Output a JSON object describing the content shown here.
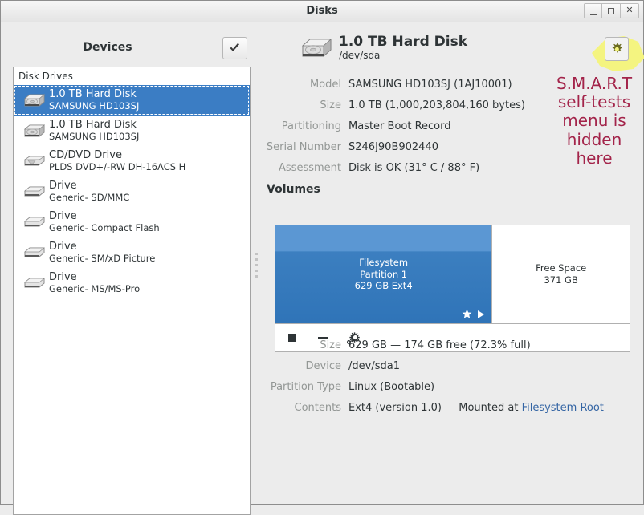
{
  "window": {
    "title": "Disks",
    "buttons": {
      "minimize": "minimize-button",
      "maximize": "maximize-button",
      "close": "close-button"
    }
  },
  "sidebar": {
    "header": "Devices",
    "toggle_icon": "check-icon",
    "list_header": "Disk Drives",
    "items": [
      {
        "name": "1.0 TB Hard Disk",
        "sub": "SAMSUNG HD103SJ",
        "icon": "hard-disk-icon",
        "selected": true
      },
      {
        "name": "1.0 TB Hard Disk",
        "sub": "SAMSUNG HD103SJ",
        "icon": "hard-disk-icon",
        "selected": false
      },
      {
        "name": "CD/DVD Drive",
        "sub": "PLDS DVD+/-RW DH-16ACS  H",
        "icon": "optical-drive-icon",
        "selected": false
      },
      {
        "name": "Drive",
        "sub": "Generic- SD/MMC",
        "icon": "removable-drive-icon",
        "selected": false
      },
      {
        "name": "Drive",
        "sub": "Generic- Compact Flash",
        "icon": "removable-drive-icon",
        "selected": false
      },
      {
        "name": "Drive",
        "sub": "Generic- SM/xD Picture",
        "icon": "removable-drive-icon",
        "selected": false
      },
      {
        "name": "Drive",
        "sub": "Generic- MS/MS-Pro",
        "icon": "removable-drive-icon",
        "selected": false
      }
    ]
  },
  "disk": {
    "title": "1.0 TB Hard Disk",
    "device_path": "/dev/sda",
    "icon": "hard-disk-icon",
    "details": [
      {
        "label": "Model",
        "value": "SAMSUNG HD103SJ (1AJ10001)"
      },
      {
        "label": "Size",
        "value": "1.0 TB (1,000,203,804,160 bytes)"
      },
      {
        "label": "Partitioning",
        "value": "Master Boot Record"
      },
      {
        "label": "Serial Number",
        "value": "S246J90B902440"
      },
      {
        "label": "Assessment",
        "value": "Disk is OK (31° C / 88° F)"
      }
    ]
  },
  "volumes": {
    "section_title": "Volumes",
    "partitions": [
      {
        "kind": "used",
        "line1": "Filesystem",
        "line2": "Partition 1",
        "line3": "629 GB Ext4",
        "width_percent": 61.3,
        "flags": [
          "star-icon",
          "play-icon"
        ]
      },
      {
        "kind": "free",
        "line1": "Free Space",
        "line2": "371 GB",
        "line3": "",
        "width_percent": 38.7,
        "flags": []
      }
    ],
    "toolbar": [
      {
        "icon": "stop-icon",
        "name": "unmount-button"
      },
      {
        "icon": "minus-icon",
        "name": "delete-partition-button"
      },
      {
        "icon": "gear-icon",
        "name": "more-actions-button"
      }
    ],
    "details": [
      {
        "label": "Size",
        "value": "629 GB — 174 GB free (72.3% full)",
        "link": ""
      },
      {
        "label": "Device",
        "value": "/dev/sda1",
        "link": ""
      },
      {
        "label": "Partition Type",
        "value": "Linux (Bootable)",
        "link": ""
      },
      {
        "label": "Contents",
        "value": "Ext4 (version 1.0) — Mounted at ",
        "link": "Filesystem Root"
      }
    ]
  },
  "annotation": {
    "text": "S.M.A.R.T self-tests menu is hidden here",
    "lines": [
      "S.M.A.R.T",
      "self-tests",
      "menu is",
      "hidden",
      "here"
    ],
    "color": "#a3244a",
    "highlight_color": "#f4f47a",
    "gear_icon": "gear-icon"
  },
  "colors": {
    "selection_blue": "#3b7dc4",
    "partition_blue": "#3c7fc0",
    "link_blue": "#3465a4",
    "window_bg": "#ececec",
    "label_gray": "#939795"
  }
}
